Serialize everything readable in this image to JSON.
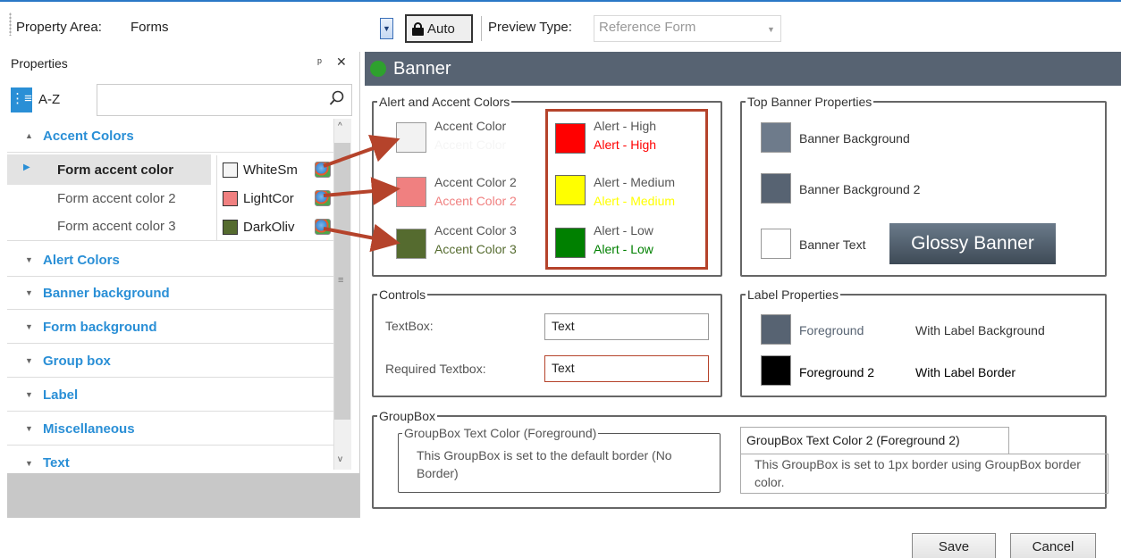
{
  "toolbar": {
    "property_area_label": "Property Area:",
    "property_area_value": "Forms",
    "auto_label": "Auto",
    "preview_type_label": "Preview Type:",
    "preview_type_value": "Reference Form"
  },
  "properties": {
    "title": "Properties",
    "pin": "⍑",
    "close": "✕",
    "sort_categorized": "≡",
    "sort_az": "A-Z",
    "categories": [
      {
        "label": "Accent Colors",
        "expanded": true
      },
      {
        "label": "Alert Colors"
      },
      {
        "label": "Banner background"
      },
      {
        "label": "Form background"
      },
      {
        "label": "Group box"
      },
      {
        "label": "Label"
      },
      {
        "label": "Miscellaneous"
      },
      {
        "label": "Text"
      }
    ],
    "rows": [
      {
        "name": "Form accent color",
        "value": "WhiteSm",
        "swatch": "#f5f5f5"
      },
      {
        "name": "Form accent color 2",
        "value": "LightCor",
        "swatch": "#f08080"
      },
      {
        "name": "Form accent color 3",
        "value": "DarkOliv",
        "swatch": "#556b2f"
      }
    ]
  },
  "banner": {
    "title": "Banner",
    "dot_color": "#2ea12e",
    "bg_color": "#576372"
  },
  "alert_accent": {
    "legend": "Alert and Accent Colors",
    "accent": [
      {
        "label": "Accent Color",
        "sub": "Accent Color",
        "color": "#f2f2f2",
        "sub_color": "#f5f5f5"
      },
      {
        "label": "Accent Color 2",
        "sub": "Accent Color 2",
        "color": "#f08080",
        "sub_color": "#f08080"
      },
      {
        "label": "Accent Color 3",
        "sub": "Accent Color 3",
        "color": "#556b2f",
        "sub_color": "#556b2f"
      }
    ],
    "alerts": [
      {
        "label": "Alert - High",
        "sub": "Alert - High",
        "color": "#ff0000",
        "sub_color": "#ff0000"
      },
      {
        "label": "Alert - Medium",
        "sub": "Alert - Medium",
        "color": "#ffff00",
        "sub_color": "#ffff00"
      },
      {
        "label": "Alert - Low",
        "sub": "Alert - Low",
        "color": "#008000",
        "sub_color": "#008000"
      }
    ]
  },
  "top_banner": {
    "legend": "Top Banner Properties",
    "items": [
      {
        "label": "Banner Background",
        "color": "#6e7b8b"
      },
      {
        "label": "Banner Background 2",
        "color": "#576372"
      },
      {
        "label": "Banner Text",
        "color": "#ffffff"
      }
    ],
    "glossy": "Glossy Banner"
  },
  "controls": {
    "legend": "Controls",
    "textbox_label": "TextBox:",
    "textbox_value": "Text",
    "required_label": "Required Textbox:",
    "required_value": "Text"
  },
  "label_props": {
    "legend": "Label Properties",
    "fg_label": "Foreground",
    "fg_color": "#576372",
    "fg_extra": "With Label Background",
    "fg2_label": "Foreground 2",
    "fg2_color": "#000000",
    "fg2_extra": "With Label Border"
  },
  "groupbox": {
    "legend": "GroupBox",
    "inner_legend": "GroupBox Text Color (Foreground)",
    "inner_text": "This GroupBox is set to the default border (No Border)",
    "tab_label": "GroupBox Text Color 2 (Foreground 2)",
    "tab_text": "This GroupBox is set to 1px border using GroupBox border color."
  },
  "footer": {
    "save": "Save",
    "cancel": "Cancel"
  }
}
